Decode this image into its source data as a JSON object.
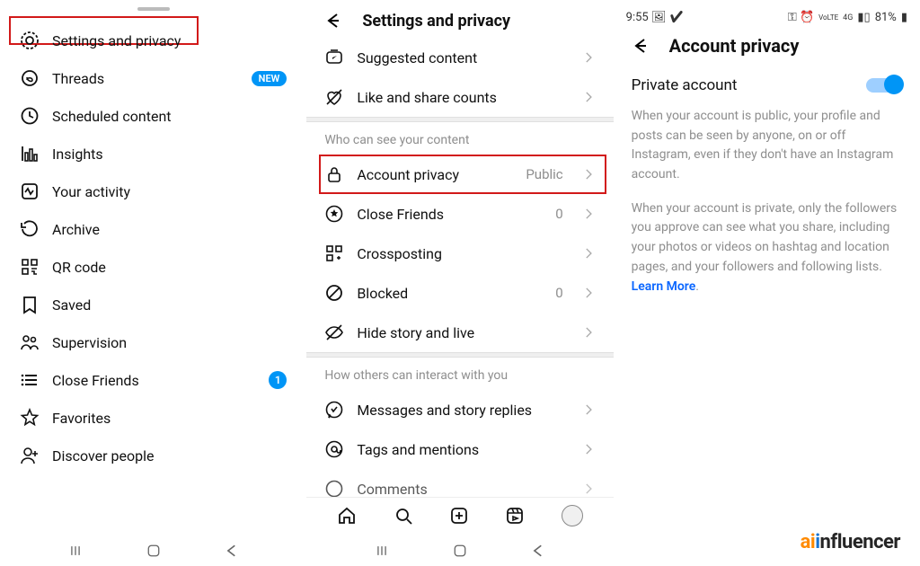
{
  "panel1": {
    "items": [
      "Settings and privacy",
      "Threads",
      "Scheduled content",
      "Insights",
      "Your activity",
      "Archive",
      "QR code",
      "Saved",
      "Supervision",
      "Close Friends",
      "Favorites",
      "Discover people"
    ],
    "badge_new": "NEW",
    "badge_num": "1"
  },
  "panel2": {
    "title": "Settings and privacy",
    "top_items": [
      "Suggested content",
      "Like and share counts"
    ],
    "section_a": "Who can see your content",
    "rows_a": {
      "account_privacy": "Account privacy",
      "account_privacy_val": "Public",
      "close_friends": "Close Friends",
      "close_friends_val": "0",
      "crossposting": "Crossposting",
      "blocked": "Blocked",
      "blocked_val": "0",
      "hide_story": "Hide story and live"
    },
    "section_b": "How others can interact with you",
    "rows_b": {
      "messages": "Messages and story replies",
      "tags": "Tags and mentions",
      "comments": "Comments"
    }
  },
  "panel3": {
    "status_time": "9:55",
    "status_batt": "81%",
    "title": "Account privacy",
    "private_label": "Private account",
    "para1": "When your account is public, your profile and posts can be seen by anyone, on or off Instagram, even if they don't have an Instagram account.",
    "para2": "When your account is private, only the followers you approve can see what you share, including your photos or videos on hashtag and location pages, and your followers and following lists. ",
    "learn_more": "Learn More"
  },
  "watermark": {
    "a": "ai",
    "b": "i",
    "c": "nfluencer"
  }
}
